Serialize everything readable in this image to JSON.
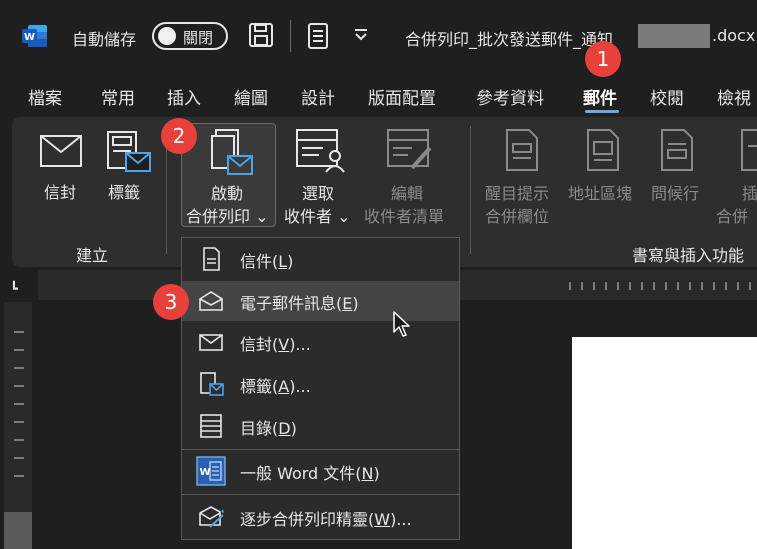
{
  "titlebar": {
    "autosave_label": "自動儲存",
    "autosave_state": "關閉",
    "filename_prefix": "合併列印_批次發送郵件_通知",
    "filename_ext": ".docx"
  },
  "tabs": [
    "檔案",
    "常用",
    "插入",
    "繪圖",
    "設計",
    "版面配置",
    "參考資料",
    "郵件",
    "校閱",
    "檢視"
  ],
  "active_tab": "郵件",
  "ribbon": {
    "envelope": "信封",
    "labels": "標籤",
    "start_line1": "啟動",
    "start_line2": "合併列印 ⌄",
    "select_line1": "選取",
    "select_line2": "收件者 ⌄",
    "edit_line1": "編輯",
    "edit_line2": "收件者清單",
    "highlight_line1": "醒目提示",
    "highlight_line2": "合併欄位",
    "address_block": "地址區塊",
    "greeting": "問候行",
    "insert_line1": "插",
    "insert_line2": "合併",
    "group_create": "建立",
    "group_write_insert": "書寫與插入功能"
  },
  "menu": {
    "items": [
      {
        "label": "信件(",
        "key": "L",
        "suffix": ")"
      },
      {
        "label": "電子郵件訊息(",
        "key": "E",
        "suffix": ")"
      },
      {
        "label": "信封(",
        "key": "V",
        "suffix": ")..."
      },
      {
        "label": "標籤(",
        "key": "A",
        "suffix": ")..."
      },
      {
        "label": "目錄(",
        "key": "D",
        "suffix": ")"
      },
      {
        "label": "一般 Word 文件(",
        "key": "N",
        "suffix": ")"
      },
      {
        "label": "逐步合併列印精靈(",
        "key": "W",
        "suffix": ")..."
      }
    ]
  },
  "badges": [
    "1",
    "2",
    "3"
  ],
  "colors": {
    "accent": "#6fa8dc",
    "badge": "#e8403a",
    "word_blue": "#2b5fb4"
  }
}
